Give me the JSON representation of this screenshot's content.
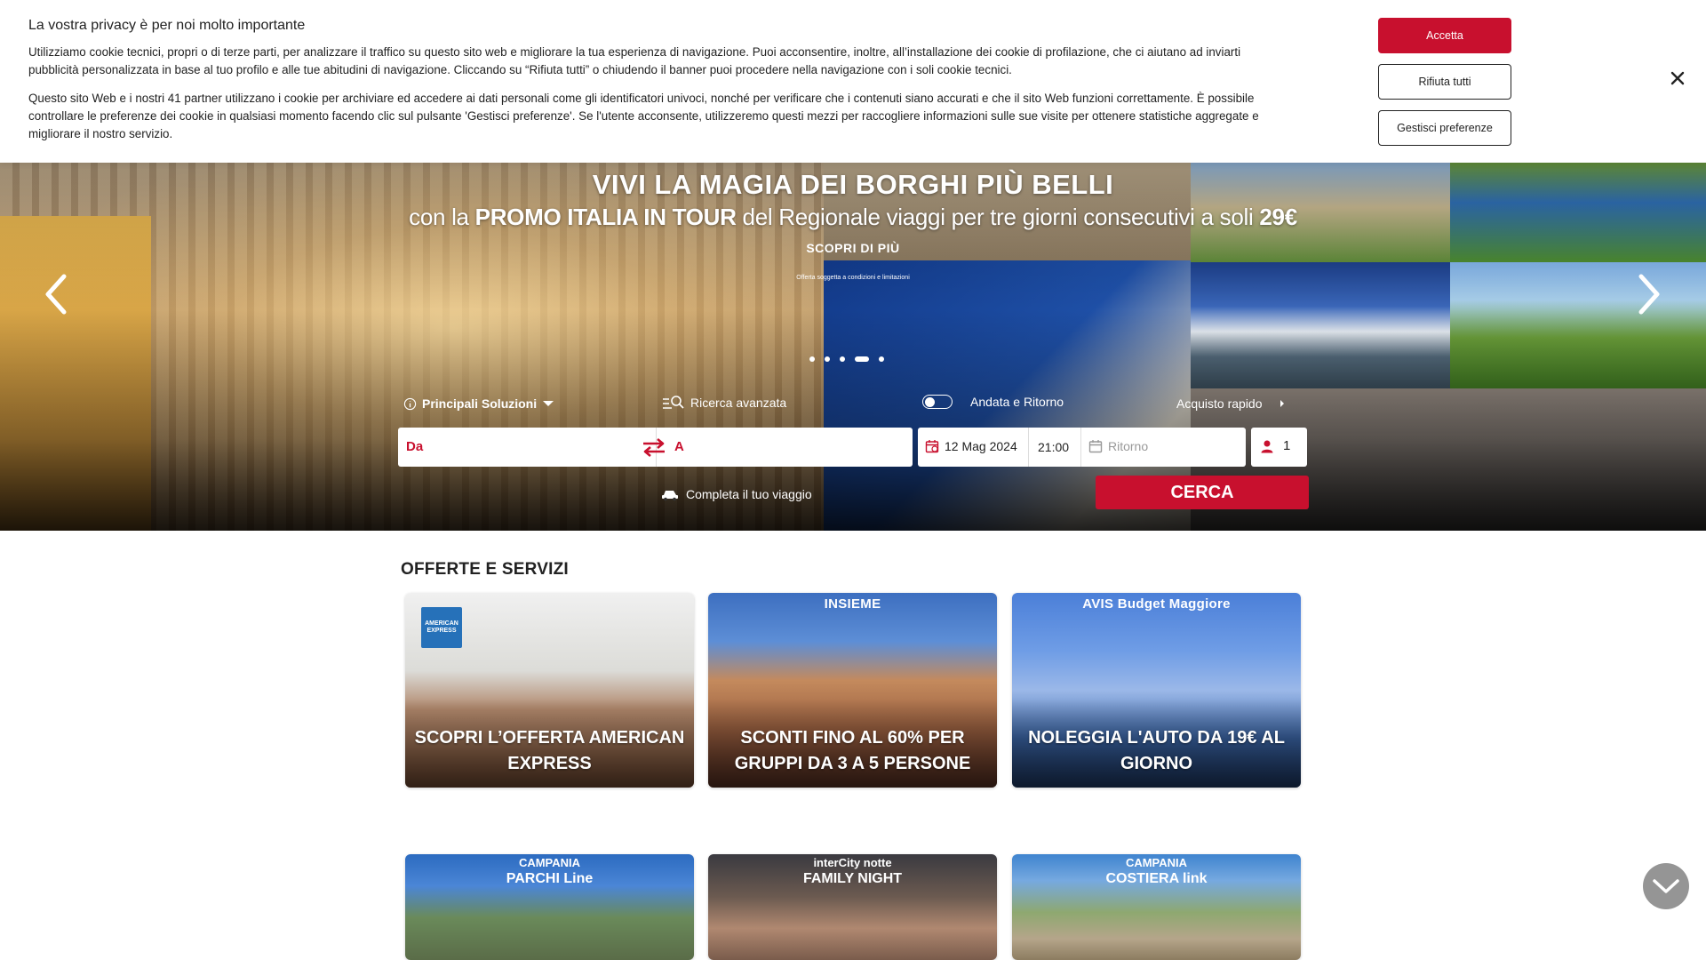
{
  "cookie": {
    "title": "La vostra privacy è per noi molto importante",
    "paragraph1": "Utilizziamo cookie tecnici, propri o di terze parti, per analizzare il traffico su questo sito web e migliorare la tua esperienza di navigazione. Puoi acconsentire, inoltre, all’installazione dei cookie di profilazione, che ci aiutano ad inviarti pubblicità personalizzata in base al tuo profilo e alle tue abitudini di navigazione. Cliccando su “Rifiuta tutti” o chiudendo il banner puoi procedere nella navigazione con i soli cookie tecnici.",
    "paragraph2": "Questo sito Web e i nostri 41 partner utilizzano i cookie per archiviare ed accedere ai dati personali come gli identificatori univoci, nonché per verificare che i contenuti siano accurati e che il sito Web funzioni correttamente. È possibile controllare le preferenze dei cookie in qualsiasi momento facendo clic sul pulsante 'Gestisci preferenze'. Se l'utente acconsente, utilizzeremo questi mezzi per raccogliere informazioni sulle sue visite per ottenere statistiche aggregate e migliorare il nostro servizio.",
    "accept_label": "Accetta",
    "reject_label": "Rifiuta tutti",
    "prefs_label": "Gestisci preferenze"
  },
  "hero": {
    "title_line1": "VIVI LA MAGIA DEI BORGHI PIÙ BELLI",
    "title_line2_prefix": "con la ",
    "title_line2_bold": "PROMO ITALIA IN TOUR",
    "title_line2_mid": " del Regionale viaggi per tre giorni consecutivi a soli ",
    "title_line2_price": "29€",
    "cta": "SCOPRI DI PIÙ",
    "note": "Offerta soggetta a condizioni e limitazioni",
    "slides": 5,
    "active_slide": 4
  },
  "search": {
    "principal_label": "Principali Soluzioni",
    "advanced_label": "Ricerca avanzata",
    "roundtrip_label": "Andata e Ritorno",
    "roundtrip_on": false,
    "quick_label": "Acquisto rapido",
    "from_placeholder": "Da",
    "to_placeholder": "A",
    "date": "12 Mag 2024",
    "time": "21:00",
    "return_placeholder": "Ritorno",
    "passengers": "1",
    "complete_label": "Completa il tuo viaggio",
    "search_label": "CERCA"
  },
  "offers": {
    "title": "OFFERTE E SERVIZI",
    "cards": [
      {
        "label": "SCOPRI L’OFFERTA AMERICAN EXPRESS",
        "brand": "AMERICAN EXPRESS"
      },
      {
        "label": "SCONTI FINO AL 60% PER GRUPPI DA 3 A 5 PERSONE",
        "brand": "INSIEME"
      },
      {
        "label": "NOLEGGIA L'AUTO DA 19€ AL GIORNO",
        "brand": "AVIS  Budget  Maggiore"
      },
      {
        "brand_small": "CAMPANIA",
        "brand_big": "PARCHI Line"
      },
      {
        "brand_small": "interCity notte",
        "brand_big": "FAMILY NIGHT"
      },
      {
        "brand_small": "CAMPANIA",
        "brand_big": "COSTIERA link"
      }
    ]
  },
  "colors": {
    "accent": "#c8102e"
  }
}
